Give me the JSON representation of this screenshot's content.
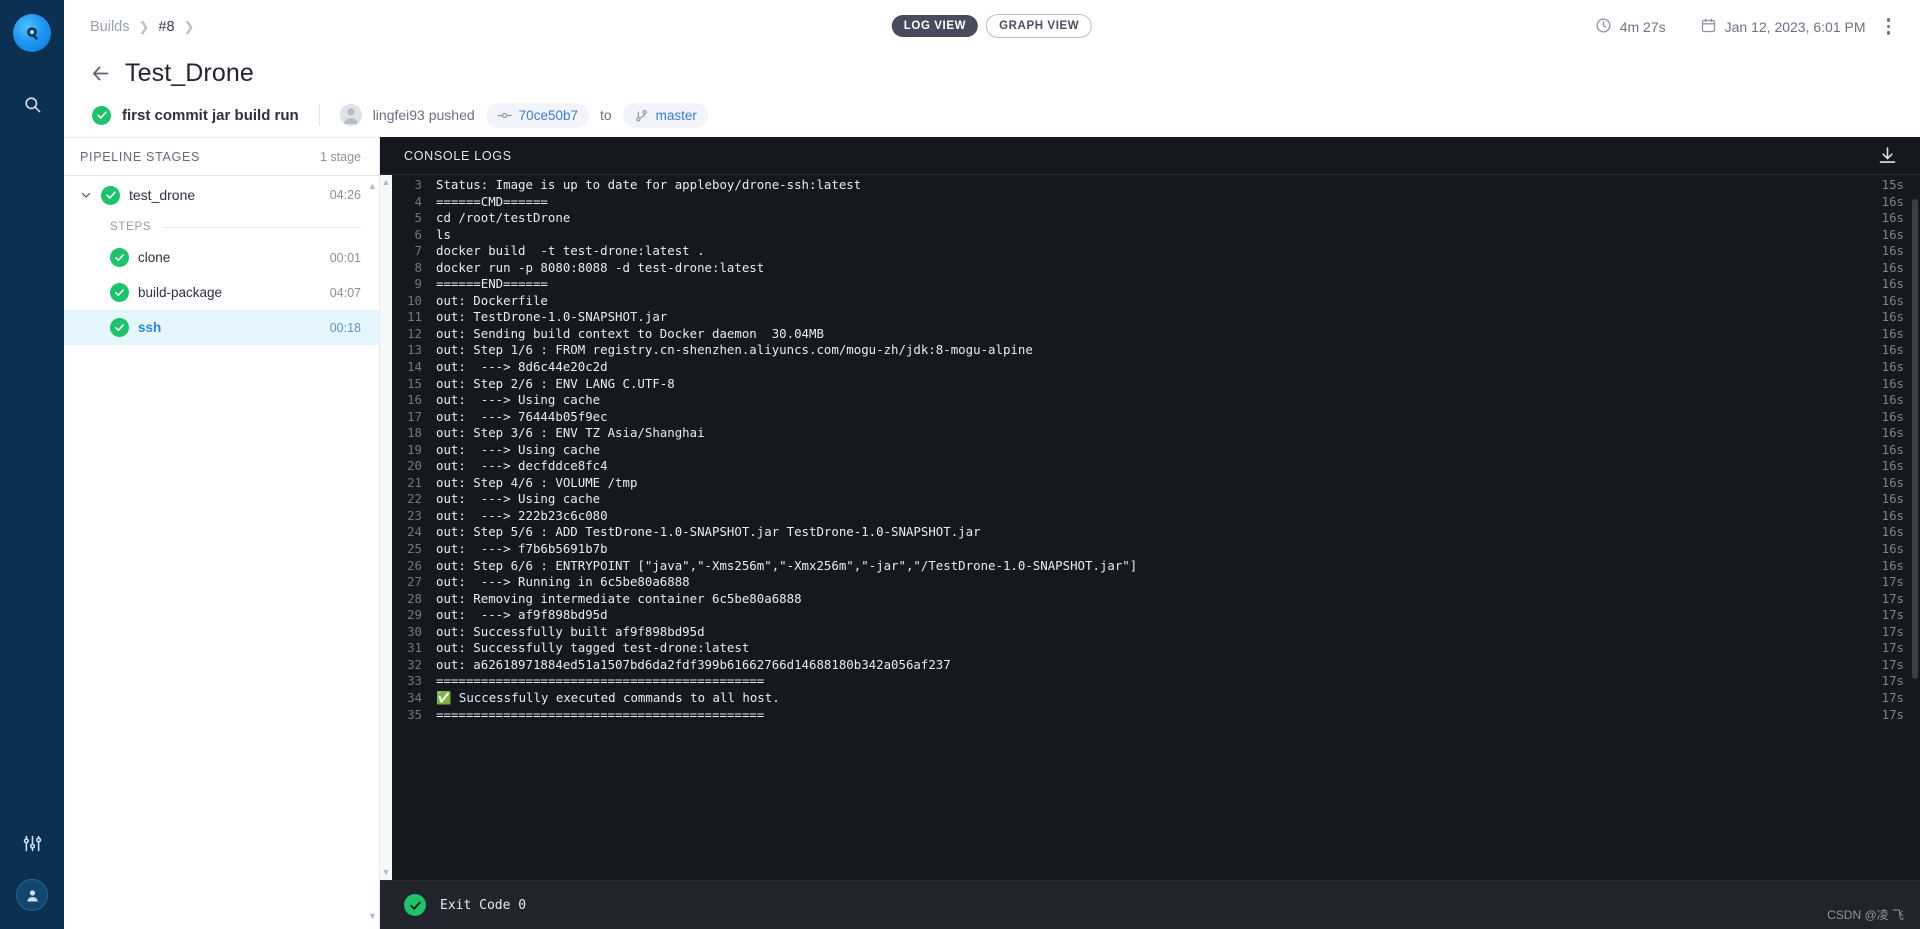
{
  "rail": {
    "logo_icon": "drone-logo-icon",
    "search_icon": "search-icon",
    "settings_icon": "sliders-icon",
    "avatar_icon": "user-avatar-icon"
  },
  "header": {
    "breadcrumb": [
      {
        "label": "Builds",
        "type": "link"
      },
      {
        "label": "#8",
        "type": "current"
      }
    ],
    "view_toggle": {
      "active": "LOG VIEW",
      "inactive": "GRAPH VIEW"
    },
    "duration": "4m 27s",
    "duration_icon": "clock-icon",
    "date": "Jan 12, 2023, 6:01 PM",
    "date_icon": "calendar-icon",
    "menu_icon": "kebab-menu-icon"
  },
  "title": {
    "back_icon": "back-arrow-icon",
    "text": "Test_Drone",
    "status_icon": "check-circle-icon",
    "commit_message": "first commit jar build run",
    "pusher": "lingfei93 pushed",
    "avatar_icon": "user-avatar-icon",
    "commit_sha": "70ce50b7",
    "commit_icon": "commit-icon",
    "to_label": "to",
    "branch": "master",
    "branch_icon": "branch-icon"
  },
  "stages": {
    "header": "PIPELINE STAGES",
    "count": "1 stage",
    "chevron_icon": "chevron-down-icon",
    "stage": {
      "name": "test_drone",
      "time": "04:26",
      "status_icon": "check-circle-icon"
    },
    "steps_label": "STEPS",
    "steps": [
      {
        "name": "clone",
        "time": "00:01",
        "status_icon": "check-circle-icon",
        "selected": false
      },
      {
        "name": "build-package",
        "time": "04:07",
        "status_icon": "check-circle-icon",
        "selected": false
      },
      {
        "name": "ssh",
        "time": "00:18",
        "status_icon": "check-circle-icon",
        "selected": true
      }
    ]
  },
  "console": {
    "header": "CONSOLE LOGS",
    "download_icon": "download-icon",
    "lines": [
      {
        "n": "3",
        "text": "Status: Image is up to date for appleboy/drone-ssh:latest",
        "dur": "15s"
      },
      {
        "n": "4",
        "text": "======CMD======",
        "dur": "16s"
      },
      {
        "n": "5",
        "text": "cd /root/testDrone",
        "dur": "16s"
      },
      {
        "n": "6",
        "text": "ls",
        "dur": "16s"
      },
      {
        "n": "7",
        "text": "docker build  -t test-drone:latest .",
        "dur": "16s"
      },
      {
        "n": "8",
        "text": "docker run -p 8080:8088 -d test-drone:latest",
        "dur": "16s"
      },
      {
        "n": "9",
        "text": "======END======",
        "dur": "16s"
      },
      {
        "n": "10",
        "text": "out: Dockerfile",
        "dur": "16s"
      },
      {
        "n": "11",
        "text": "out: TestDrone-1.0-SNAPSHOT.jar",
        "dur": "16s"
      },
      {
        "n": "12",
        "text": "out: Sending build context to Docker daemon  30.04MB",
        "dur": "16s"
      },
      {
        "n": "13",
        "text": "out: Step 1/6 : FROM registry.cn-shenzhen.aliyuncs.com/mogu-zh/jdk:8-mogu-alpine",
        "dur": "16s"
      },
      {
        "n": "14",
        "text": "out:  ---> 8d6c44e20c2d",
        "dur": "16s"
      },
      {
        "n": "15",
        "text": "out: Step 2/6 : ENV LANG C.UTF-8",
        "dur": "16s"
      },
      {
        "n": "16",
        "text": "out:  ---> Using cache",
        "dur": "16s"
      },
      {
        "n": "17",
        "text": "out:  ---> 76444b05f9ec",
        "dur": "16s"
      },
      {
        "n": "18",
        "text": "out: Step 3/6 : ENV TZ Asia/Shanghai",
        "dur": "16s"
      },
      {
        "n": "19",
        "text": "out:  ---> Using cache",
        "dur": "16s"
      },
      {
        "n": "20",
        "text": "out:  ---> decfddce8fc4",
        "dur": "16s"
      },
      {
        "n": "21",
        "text": "out: Step 4/6 : VOLUME /tmp",
        "dur": "16s"
      },
      {
        "n": "22",
        "text": "out:  ---> Using cache",
        "dur": "16s"
      },
      {
        "n": "23",
        "text": "out:  ---> 222b23c6c080",
        "dur": "16s"
      },
      {
        "n": "24",
        "text": "out: Step 5/6 : ADD TestDrone-1.0-SNAPSHOT.jar TestDrone-1.0-SNAPSHOT.jar",
        "dur": "16s"
      },
      {
        "n": "25",
        "text": "out:  ---> f7b6b5691b7b",
        "dur": "16s"
      },
      {
        "n": "26",
        "text": "out: Step 6/6 : ENTRYPOINT [\"java\",\"-Xms256m\",\"-Xmx256m\",\"-jar\",\"/TestDrone-1.0-SNAPSHOT.jar\"]",
        "dur": "16s"
      },
      {
        "n": "27",
        "text": "out:  ---> Running in 6c5be80a6888",
        "dur": "17s"
      },
      {
        "n": "28",
        "text": "out: Removing intermediate container 6c5be80a6888",
        "dur": "17s"
      },
      {
        "n": "29",
        "text": "out:  ---> af9f898bd95d",
        "dur": "17s"
      },
      {
        "n": "30",
        "text": "out: Successfully built af9f898bd95d",
        "dur": "17s"
      },
      {
        "n": "31",
        "text": "out: Successfully tagged test-drone:latest",
        "dur": "17s"
      },
      {
        "n": "32",
        "text": "out: a62618971884ed51a1507bd6da2fdf399b61662766d14688180b342a056af237",
        "dur": "17s"
      },
      {
        "n": "33",
        "text": "============================================",
        "dur": "17s"
      },
      {
        "n": "34",
        "text": "✅ Successfully executed commands to all host.",
        "dur": "17s"
      },
      {
        "n": "35",
        "text": "============================================",
        "dur": "17s"
      }
    ],
    "footer": {
      "status_icon": "check-circle-icon",
      "exit_text": "Exit Code 0"
    }
  },
  "watermark": "CSDN @凌 飞",
  "colors": {
    "rail_bg": "#0b3052",
    "console_bg": "#16181f",
    "success_green": "#1ec26b",
    "accent_blue": "#3a7bd5",
    "selected_row": "#e5f6fd"
  }
}
